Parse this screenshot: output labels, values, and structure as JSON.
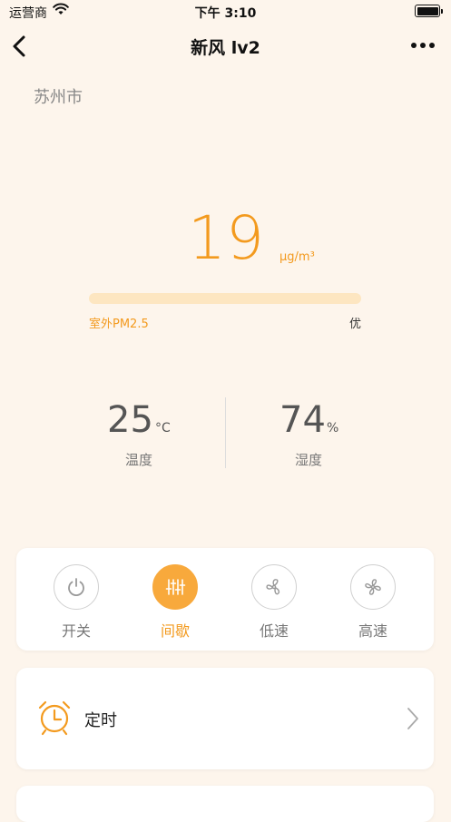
{
  "status_bar": {
    "carrier": "运营商",
    "time": "下午 3:10"
  },
  "nav": {
    "title": "新风 lv2"
  },
  "city": "苏州市",
  "pm25": {
    "value": "19",
    "unit": "μg/m³",
    "label": "室外PM2.5",
    "level": "优"
  },
  "temperature": {
    "value": "25",
    "unit": "°C",
    "label": "温度"
  },
  "humidity": {
    "value": "74",
    "unit": "%",
    "label": "湿度"
  },
  "modes": [
    {
      "label": "开关",
      "icon": "power-icon",
      "active": false
    },
    {
      "label": "间歇",
      "icon": "sliders-icon",
      "active": true
    },
    {
      "label": "低速",
      "icon": "fan-low-icon",
      "active": false
    },
    {
      "label": "高速",
      "icon": "fan-high-icon",
      "active": false
    }
  ],
  "timer": {
    "label": "定时",
    "icon": "alarm-clock-icon"
  },
  "colors": {
    "accent": "#f39a1e",
    "background": "#fdf5ec",
    "card": "#ffffff"
  }
}
